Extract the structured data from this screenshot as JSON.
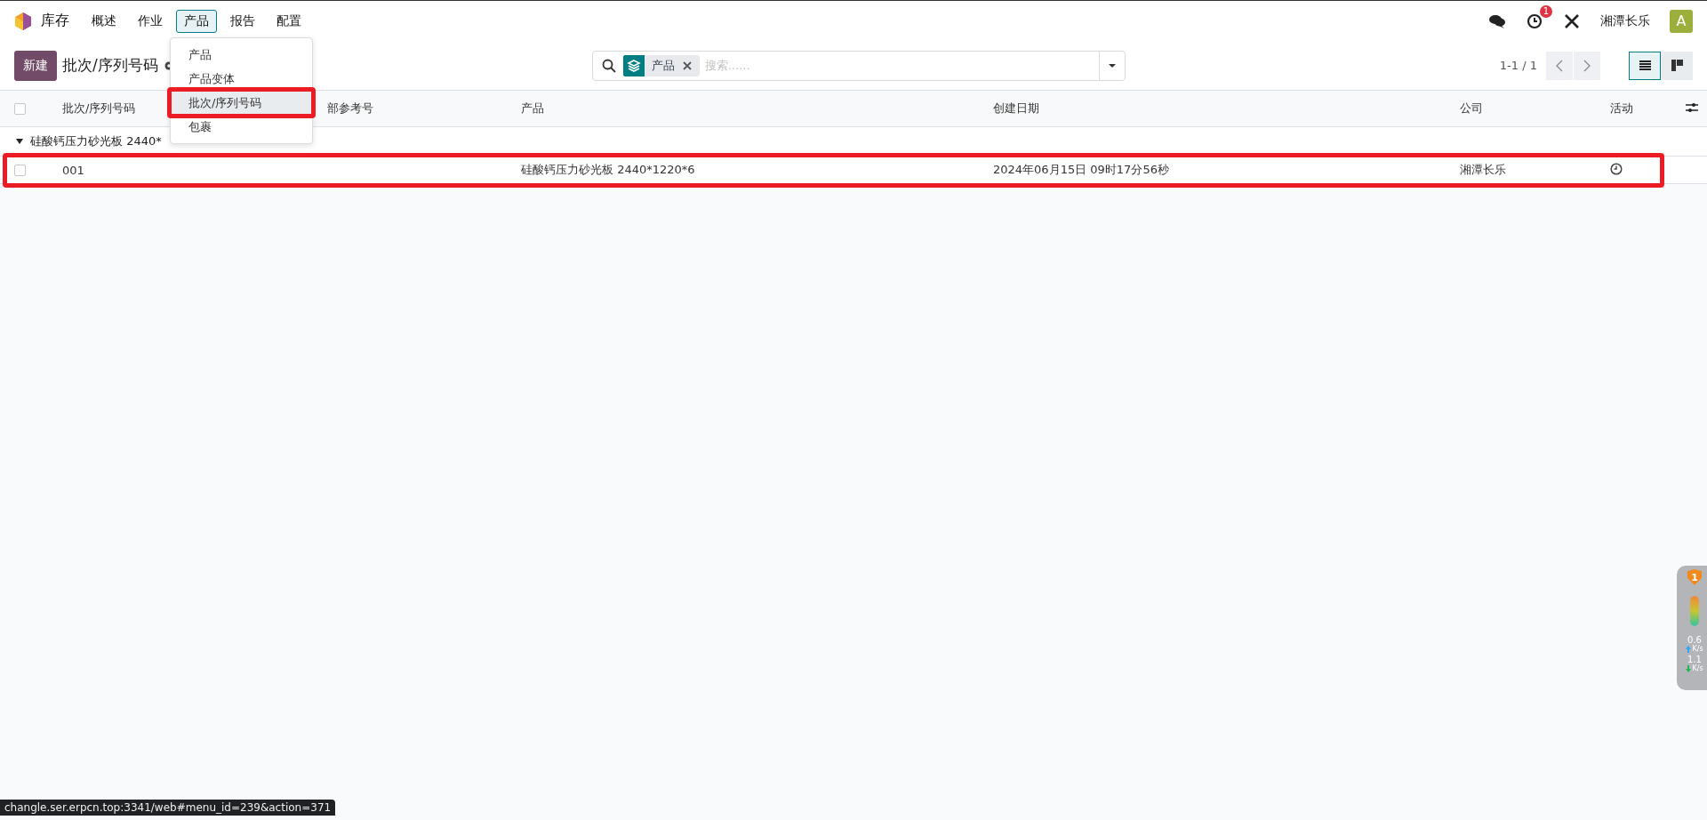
{
  "navbar": {
    "app_name": "库存",
    "menu": [
      {
        "label": "概述",
        "selected": false
      },
      {
        "label": "作业",
        "selected": false
      },
      {
        "label": "产品",
        "selected": true
      },
      {
        "label": "报告",
        "selected": false
      },
      {
        "label": "配置",
        "selected": false
      }
    ],
    "activity_badge": "1",
    "company": "湘潭长乐",
    "avatar": "A"
  },
  "dropdown": {
    "items": [
      {
        "label": "产品",
        "selected": false,
        "marked": false
      },
      {
        "label": "产品变体",
        "selected": false,
        "marked": false
      },
      {
        "label": "批次/序列号码",
        "selected": true,
        "marked": true
      },
      {
        "label": "包裹",
        "selected": false,
        "marked": false
      }
    ]
  },
  "control_panel": {
    "new_button": "新建",
    "title": "批次/序列号码",
    "search": {
      "facet": "产品",
      "placeholder": "搜索......"
    },
    "pager": "1-1 / 1",
    "views": [
      {
        "kind": "list",
        "selected": true
      },
      {
        "kind": "kanban",
        "selected": false
      }
    ]
  },
  "table": {
    "select_all": {
      "checked": false
    },
    "columns": [
      "批次/序列号码",
      "部参考号",
      "产品",
      "创建日期",
      "公司",
      "活动"
    ],
    "groups": [
      {
        "label": "硅酸钙压力砂光板 2440*",
        "expanded": true,
        "rows": [
          {
            "checked": false,
            "marked": true,
            "cells": [
              "001",
              "",
              "硅酸钙压力砂光板 2440*1220*6",
              "2024年06月15日 09时17分56秒",
              "湘潭长乐"
            ]
          }
        ]
      }
    ]
  },
  "net_widget": {
    "badge": "1",
    "upload": "0.6",
    "upload_unit": "K/s",
    "download": "1.1",
    "download_unit": "K/s"
  },
  "status_url": "changle.ser.erpcn.top:3341/web#menu_id=239&action=371"
}
